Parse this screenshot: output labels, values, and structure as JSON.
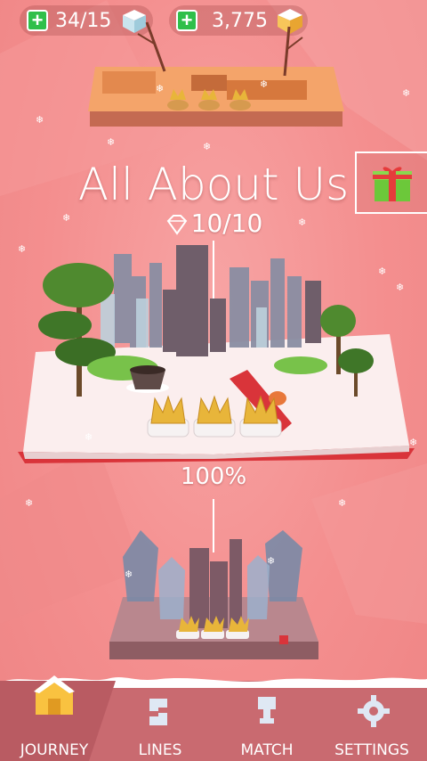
{
  "top_bar": {
    "lives": "34/15",
    "currency": "3,775"
  },
  "level": {
    "title": "All About Us",
    "gems": "10/10",
    "progress": "100%"
  },
  "nav": {
    "items": [
      {
        "label": "JOURNEY"
      },
      {
        "label": "LINES"
      },
      {
        "label": "MATCH"
      },
      {
        "label": "SETTINGS"
      }
    ]
  },
  "colors": {
    "background": "#f48f8f",
    "nav_bar": "#c96a70",
    "plus_green": "#2fbf4a",
    "book_red": "#d9343a",
    "crown_gold": "#e8b53a"
  }
}
